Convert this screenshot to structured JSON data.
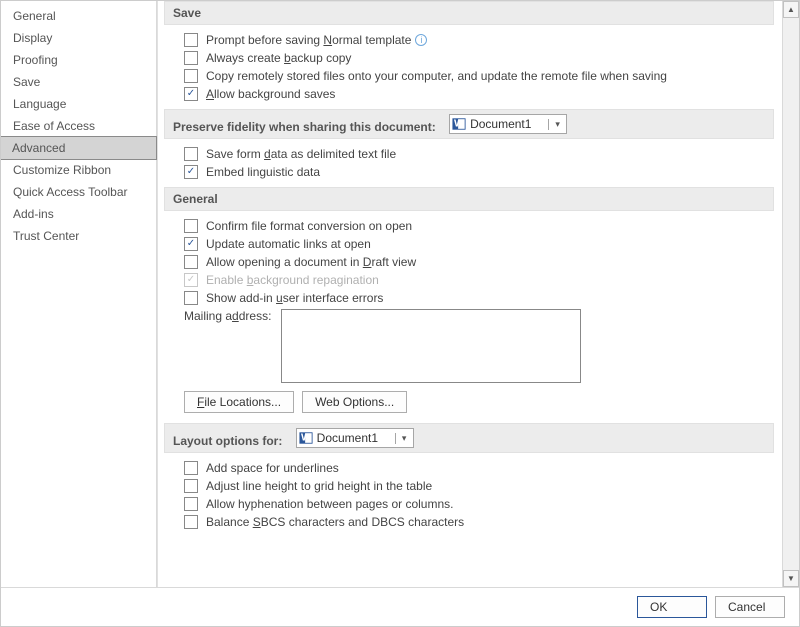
{
  "sidebar": {
    "items": [
      {
        "label": "General"
      },
      {
        "label": "Display"
      },
      {
        "label": "Proofing"
      },
      {
        "label": "Save"
      },
      {
        "label": "Language"
      },
      {
        "label": "Ease of Access"
      },
      {
        "label": "Advanced",
        "selected": true
      },
      {
        "label": "Customize Ribbon"
      },
      {
        "label": "Quick Access Toolbar"
      },
      {
        "label": "Add-ins"
      },
      {
        "label": "Trust Center"
      }
    ]
  },
  "sections": {
    "save": {
      "title": "Save",
      "prompt_normal": {
        "label_pre": "Prompt before saving ",
        "label_u": "N",
        "label_post": "ormal template",
        "checked": false,
        "info": true
      },
      "backup_copy": {
        "label_pre": "Always create ",
        "label_u": "b",
        "label_post": "ackup copy",
        "checked": false
      },
      "copy_remote": {
        "label_pre": "Copy remotely stored files onto your computer, and update the remote file when saving",
        "checked": false
      },
      "bg_saves": {
        "label_pre": "",
        "label_u": "A",
        "label_post": "llow background saves",
        "checked": true
      }
    },
    "preserve": {
      "title": "Preserve fidelity when sharing this document:",
      "doc": "Document1",
      "save_form_data": {
        "label_pre": "Save form ",
        "label_u": "d",
        "label_post": "ata as delimited text file",
        "checked": false
      },
      "embed_ling": {
        "label_pre": "Embed linguistic data",
        "checked": true
      }
    },
    "general": {
      "title": "General",
      "confirm_conv": {
        "label_pre": "Confirm file format conversion on open",
        "checked": false
      },
      "auto_links": {
        "label_pre": "Update automatic links at open",
        "checked": true
      },
      "draft_view": {
        "label_pre": "Allow opening a document in ",
        "label_u": "D",
        "label_post": "raft view",
        "checked": false
      },
      "bg_repag": {
        "label_pre": "Enable ",
        "label_u": "b",
        "label_post": "ackground repagination",
        "checked": true,
        "disabled": true
      },
      "addin_errors": {
        "label_pre": "Show add-in ",
        "label_u": "u",
        "label_post": "ser interface errors",
        "checked": false
      },
      "mailing_label_pre": "Mailing a",
      "mailing_label_u": "d",
      "mailing_label_post": "dress:",
      "file_locations": {
        "label_pre": "",
        "label_u": "F",
        "label_post": "ile Locations..."
      },
      "web_options": {
        "label": "Web Options..."
      }
    },
    "layout": {
      "title": "Layout options for:",
      "doc": "Document1",
      "add_space": {
        "label_pre": "Add space for underlines",
        "checked": false
      },
      "adjust_line": {
        "label_pre": "Adjust line height to grid height in the table",
        "checked": false
      },
      "allow_hyph": {
        "label_pre": "Allow hyphenation between pages or columns.",
        "checked": false
      },
      "balance_sbcs": {
        "label_pre": "Balance ",
        "label_u": "S",
        "label_post": "BCS characters and DBCS characters",
        "checked": false
      }
    }
  },
  "footer": {
    "ok": "OK",
    "cancel": "Cancel"
  }
}
